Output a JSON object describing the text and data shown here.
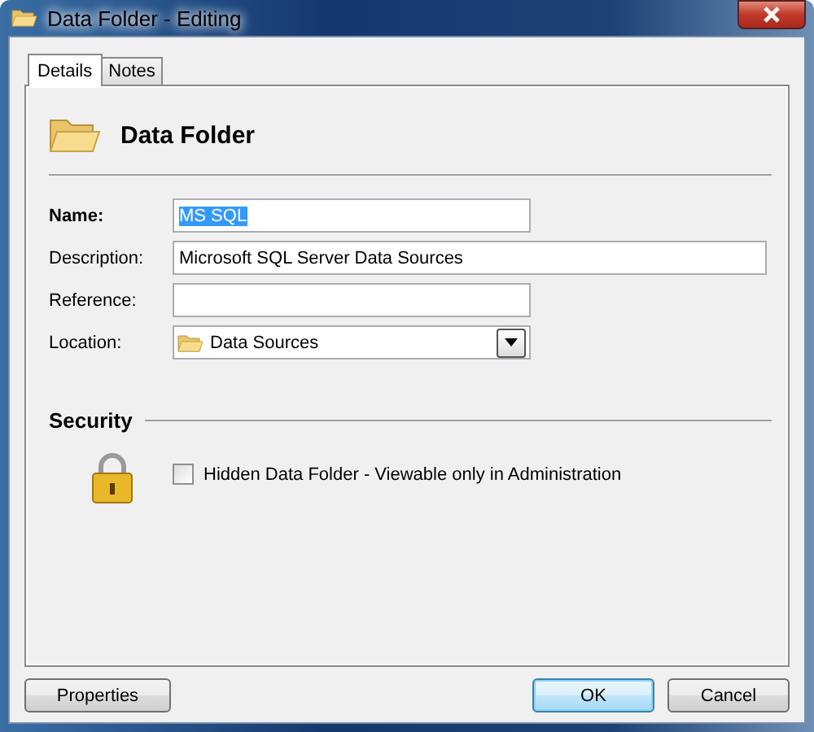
{
  "window": {
    "title": "Data Folder - Editing"
  },
  "tabs": [
    {
      "label": "Details",
      "selected": true
    },
    {
      "label": "Notes",
      "selected": false
    }
  ],
  "header": {
    "title": "Data Folder"
  },
  "fields": [
    {
      "kind": "text",
      "label": "Name:",
      "required": true,
      "value": "MS SQL",
      "highlighted": true,
      "wide": false
    },
    {
      "kind": "text",
      "label": "Description:",
      "required": false,
      "value": "Microsoft SQL Server Data Sources",
      "highlighted": false,
      "wide": true
    },
    {
      "kind": "text",
      "label": "Reference:",
      "required": false,
      "wide": false
    },
    {
      "kind": "select",
      "label": "Location:",
      "required": false,
      "value": "Data Sources"
    }
  ],
  "security": {
    "title": "Security",
    "option": {
      "label": "Hidden Data Folder - Viewable only in Administration",
      "checked": false
    }
  },
  "buttons": [
    {
      "label": "Properties",
      "default": false
    },
    {
      "label": "OK",
      "default": true
    },
    {
      "label": "Cancel",
      "default": false
    }
  ]
}
